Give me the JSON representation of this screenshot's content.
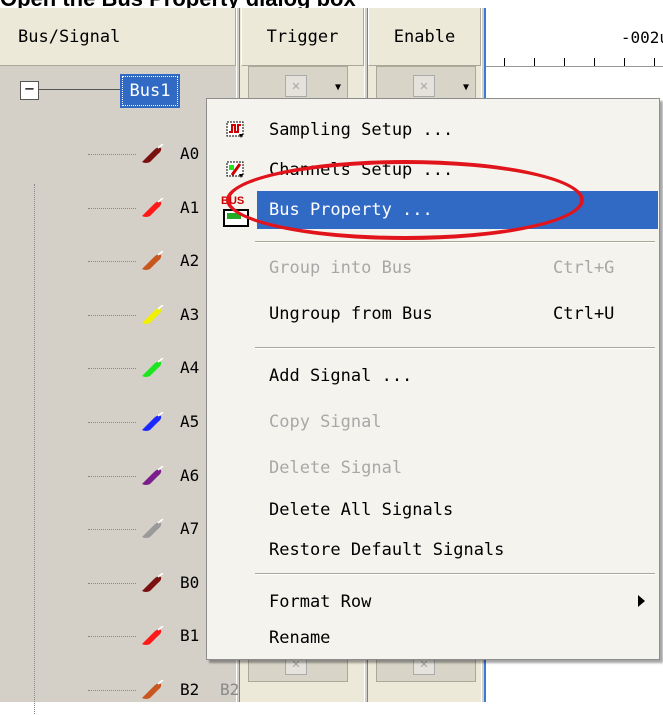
{
  "caption": {
    "text": "Open the Bus Property dialog box"
  },
  "header": {
    "bus_signal": "Bus/Signal",
    "trigger": "Trigger",
    "enable": "Enable",
    "time": "-002u"
  },
  "bus": {
    "name": "Bus1",
    "expander": "−"
  },
  "signals": [
    {
      "name": "A0",
      "color": "#7a1010"
    },
    {
      "name": "A1",
      "color": "#ff1a1a"
    },
    {
      "name": "A2",
      "color": "#c8561e"
    },
    {
      "name": "A3",
      "color": "#f0f000"
    },
    {
      "name": "A4",
      "color": "#1ee61e"
    },
    {
      "name": "A5",
      "color": "#1a28ff"
    },
    {
      "name": "A6",
      "color": "#7a1e8c"
    },
    {
      "name": "A7",
      "color": "#9a9a9a"
    },
    {
      "name": "B0",
      "color": "#7a1010"
    },
    {
      "name": "B1",
      "color": "#ff1a1a"
    },
    {
      "name": "B2",
      "color": "#c8561e",
      "extra": "B2"
    }
  ],
  "menu": {
    "sampling_setup": "Sampling Setup ...",
    "channels_setup": "Channels Setup ...",
    "bus_property": "Bus Property ...",
    "group_into_bus": "Group into Bus",
    "group_into_bus_shortcut": "Ctrl+G",
    "ungroup_from_bus": "Ungroup from Bus",
    "ungroup_from_bus_shortcut": "Ctrl+U",
    "add_signal": "Add Signal ...",
    "copy_signal": "Copy Signal",
    "delete_signal": "Delete Signal",
    "delete_all_signals": "Delete All Signals",
    "restore_default_signals": "Restore Default Signals",
    "format_row": "Format Row",
    "rename": "Rename",
    "bus_icon_text": "BUS"
  },
  "colors": {
    "highlight": "#316ac5",
    "annotation": "#e0141a"
  }
}
